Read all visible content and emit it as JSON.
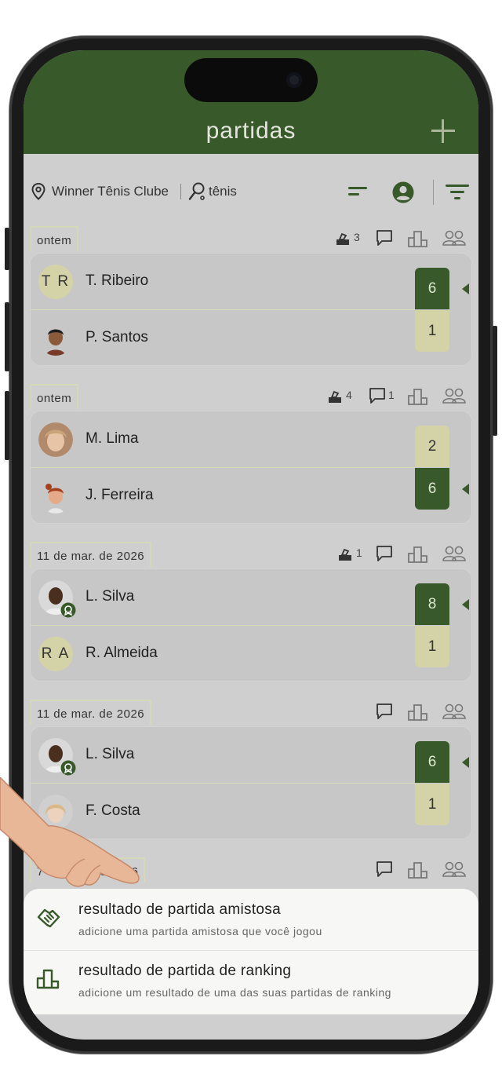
{
  "header": {
    "title": "partidas"
  },
  "filters": {
    "club": "Winner Tênis Clube",
    "sport": "tênis"
  },
  "matches": [
    {
      "date": "ontem",
      "votes": "3",
      "comments": "",
      "p1": {
        "name": "T. Ribeiro",
        "initials": "T R",
        "score": "6"
      },
      "p2": {
        "name": "P. Santos",
        "score": "1"
      }
    },
    {
      "date": "ontem",
      "votes": "4",
      "comments": "1",
      "p1": {
        "name": "M. Lima",
        "score": "2"
      },
      "p2": {
        "name": "J. Ferreira",
        "score": "6"
      }
    },
    {
      "date": "11 de mar. de 2026",
      "votes": "1",
      "comments": "",
      "p1": {
        "name": "L. Silva",
        "score": "8"
      },
      "p2": {
        "name": "R. Almeida",
        "initials": "R A",
        "score": "1"
      }
    },
    {
      "date": "11 de mar. de 2026",
      "votes": "",
      "comments": "",
      "p1": {
        "name": "L. Silva",
        "score": "6"
      },
      "p2": {
        "name": "F. Costa",
        "score": "1"
      }
    },
    {
      "date": "7 de mar. de 2026"
    }
  ],
  "sheet": {
    "options": [
      {
        "title": "resultado de partida amistosa",
        "subtitle": "adicione uma partida amistosa que você jogou"
      },
      {
        "title": "resultado de partida de ranking",
        "subtitle": "adicione um resultado de uma das suas partidas de ranking"
      }
    ]
  },
  "colors": {
    "primary": "#38592a",
    "accent": "#d4d3a8"
  },
  "icons": [
    "location-pin-icon",
    "racket-icon",
    "sort-icon",
    "user-circle-icon",
    "filter-icon",
    "vote-box-icon",
    "comment-icon",
    "ranking-podium-icon",
    "players-icon",
    "handshake-icon",
    "podium-icon"
  ]
}
